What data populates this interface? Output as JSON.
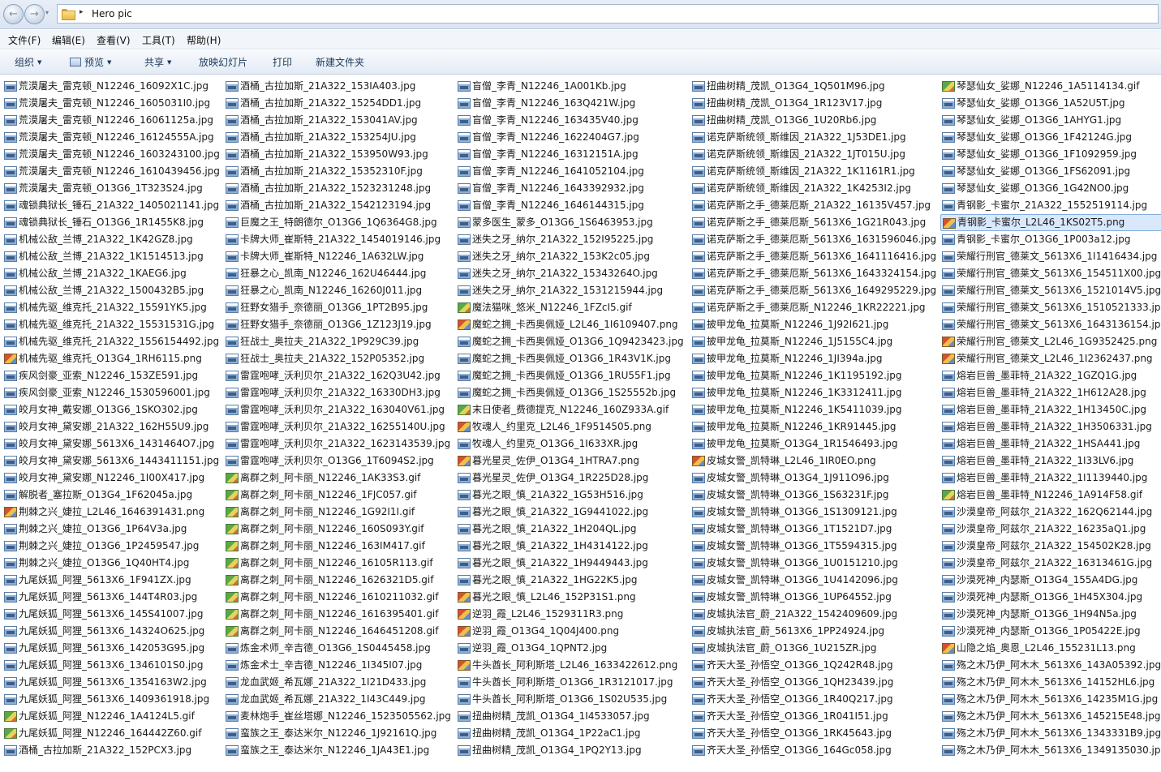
{
  "address_bar": {
    "back_icon": "←",
    "forward_icon": "→",
    "history_icon": "▾",
    "chevron_icon": "▸",
    "folder_name": "Hero pic"
  },
  "menu": [
    {
      "label": "文件(F)"
    },
    {
      "label": "编辑(E)"
    },
    {
      "label": "查看(V)"
    },
    {
      "label": "工具(T)"
    },
    {
      "label": "帮助(H)"
    }
  ],
  "toolbar": {
    "organize": "组织",
    "preview": "预览",
    "share": "共享",
    "slideshow": "放映幻灯片",
    "print": "打印",
    "new_folder": "新建文件夹",
    "arrow": "▼"
  },
  "columns": [
    [
      "荒漠屠夫_雷克顿_N12246_16092X1C.jpg",
      "荒漠屠夫_雷克顿_N12246_1605031I0.jpg",
      "荒漠屠夫_雷克顿_N12246_16061125a.jpg",
      "荒漠屠夫_雷克顿_N12246_16124555A.jpg",
      "荒漠屠夫_雷克顿_N12246_1603243100.jpg",
      "荒漠屠夫_雷克顿_N12246_1610439456.jpg",
      "荒漠屠夫_雷克顿_O13G6_1T323S24.jpg",
      "魂锁典狱长_锤石_21A322_1405021141.jpg",
      "魂锁典狱长_锤石_O13G6_1R1455K8.jpg",
      "机械公敌_兰博_21A322_1K42GZ8.jpg",
      "机械公敌_兰博_21A322_1K1514513.jpg",
      "机械公敌_兰博_21A322_1KAEG6.jpg",
      "机械公敌_兰博_21A322_1500432B5.jpg",
      "机械先驱_维克托_21A322_15591YK5.jpg",
      "机械先驱_维克托_21A322_15531531G.jpg",
      "机械先驱_维克托_21A322_1556154492.jpg",
      "机械先驱_维克托_O13G4_1RH6115.png",
      "疾风剑豪_亚索_N12246_153ZE591.jpg",
      "疾风剑豪_亚索_N12246_1530596001.jpg",
      "皎月女神_戴安娜_O13G6_1SKO302.jpg",
      "皎月女神_黛安娜_21A322_162H55U9.jpg",
      "皎月女神_黛安娜_5613X6_1431464O7.jpg",
      "皎月女神_黛安娜_5613X6_1443411151.jpg",
      "皎月女神_黛安娜_N12246_1I00X417.jpg",
      "解脱者_塞拉斯_O13G4_1F62045a.jpg",
      "荆棘之兴_婕拉_L2L46_1646391431.png",
      "荆棘之兴_婕拉_O13G6_1P64V3a.jpg",
      "荆棘之兴_婕拉_O13G6_1P2459547.jpg",
      "荆棘之兴_婕拉_O13G6_1Q40HT4.jpg",
      "九尾妖狐_阿狸_5613X6_1F941ZX.jpg",
      "九尾妖狐_阿狸_5613X6_144T4R03.jpg",
      "九尾妖狐_阿狸_5613X6_145S41007.jpg",
      "九尾妖狐_阿狸_5613X6_14324O625.jpg",
      "九尾妖狐_阿狸_5613X6_142053G95.jpg",
      "九尾妖狐_阿狸_5613X6_1346101S0.jpg",
      "九尾妖狐_阿狸_5613X6_1354163W2.jpg",
      "九尾妖狐_阿狸_5613X6_1409361918.jpg",
      "九尾妖狐_阿狸_N12246_1A4124L5.gif",
      "九尾妖狐_阿狸_N12246_164442Z60.gif",
      "酒桶_古拉加斯_21A322_152PCX3.jpg"
    ],
    [
      "酒桶_古拉加斯_21A322_153IA403.jpg",
      "酒桶_古拉加斯_21A322_15254DD1.jpg",
      "酒桶_古拉加斯_21A322_153041AV.jpg",
      "酒桶_古拉加斯_21A322_153254JU.jpg",
      "酒桶_古拉加斯_21A322_153950W93.jpg",
      "酒桶_古拉加斯_21A322_15352310F.jpg",
      "酒桶_古拉加斯_21A322_1523231248.jpg",
      "酒桶_古拉加斯_21A322_1542123194.jpg",
      "巨魔之王_特朗德尔_O13G6_1Q6364G8.jpg",
      "卡牌大师_崔斯特_21A322_1454019146.jpg",
      "卡牌大师_崔斯特_N12246_1A632LW.jpg",
      "狂暴之心_凯南_N12246_162U46444.jpg",
      "狂暴之心_凯南_N12246_16260J011.jpg",
      "狂野女猎手_奈德丽_O13G6_1PT2B95.jpg",
      "狂野女猎手_奈德丽_O13G6_1Z123J19.jpg",
      "狂战士_奥拉夫_21A322_1P929C39.jpg",
      "狂战士_奥拉夫_21A322_152P05352.jpg",
      "雷霆咆哮_沃利贝尔_21A322_162Q3U42.jpg",
      "雷霆咆哮_沃利贝尔_21A322_16330DH3.jpg",
      "雷霆咆哮_沃利贝尔_21A322_163040V61.jpg",
      "雷霆咆哮_沃利贝尔_21A322_16255140U.jpg",
      "雷霆咆哮_沃利贝尔_21A322_1623143539.jpg",
      "雷霆咆哮_沃利贝尔_O13G6_1T6094S2.jpg",
      "离群之刺_阿卡丽_N12246_1AK33S3.gif",
      "离群之刺_阿卡丽_N12246_1FJC057.gif",
      "离群之刺_阿卡丽_N12246_1G92I1I.gif",
      "离群之刺_阿卡丽_N12246_160S093Y.gif",
      "离群之刺_阿卡丽_N12246_163IM417.gif",
      "离群之刺_阿卡丽_N12246_16105R113.gif",
      "离群之刺_阿卡丽_N12246_1626321D5.gif",
      "离群之刺_阿卡丽_N12246_1610211032.gif",
      "离群之刺_阿卡丽_N12246_1616395401.gif",
      "离群之刺_阿卡丽_N12246_1646451208.gif",
      "炼金术师_辛吉德_O13G6_1S0445458.jpg",
      "炼金术士_辛吉德_N12246_1I345I07.jpg",
      "龙血武姬_希瓦娜_21A322_1I21D433.jpg",
      "龙血武姬_希瓦娜_21A322_1I43C449.jpg",
      "麦林炮手_崔丝塔娜_N12246_1523505562.jpg",
      "蛮族之王_泰达米尔_N12246_1J92161Q.jpg",
      "蛮族之王_泰达米尔_N12246_1JA43E1.jpg"
    ],
    [
      "盲僧_李青_N12246_1A001Kb.jpg",
      "盲僧_李青_N12246_163Q421W.jpg",
      "盲僧_李青_N12246_163435V40.jpg",
      "盲僧_李青_N12246_1622404G7.jpg",
      "盲僧_李青_N12246_16312151A.jpg",
      "盲僧_李青_N12246_1641052104.jpg",
      "盲僧_李青_N12246_1643392932.jpg",
      "盲僧_李青_N12246_1646144315.jpg",
      "蒙多医生_蒙多_O13G6_1S6463953.jpg",
      "迷失之牙_纳尔_21A322_152I95225.jpg",
      "迷失之牙_纳尔_21A322_153K2c05.jpg",
      "迷失之牙_纳尔_21A322_15343264O.jpg",
      "迷失之牙_纳尔_21A322_1531215944.jpg",
      "魔法猫咪_悠米_N12246_1FZcI5.gif",
      "魔蛇之拥_卡西奥佩娅_L2L46_1I6109407.png",
      "魔蛇之拥_卡西奥佩娅_O13G6_1Q9423423.jpg",
      "魔蛇之拥_卡西奥佩娅_O13G6_1R43V1K.jpg",
      "魔蛇之拥_卡西奥佩娅_O13G6_1RU55F1.jpg",
      "魔蛇之拥_卡西奥佩娅_O13G6_1S25552b.jpg",
      "末日使者_费德提克_N12246_160Z933A.gif",
      "牧魂人_约里克_L2L46_1F9514505.png",
      "牧魂人_约里克_O13G6_1I633XR.jpg",
      "暮光星灵_佐伊_O13G4_1HTRA7.png",
      "暮光星灵_佐伊_O13G4_1R225D28.jpg",
      "暮光之眼_慎_21A322_1G53H516.jpg",
      "暮光之眼_慎_21A322_1G9441022.jpg",
      "暮光之眼_慎_21A322_1H204QL.jpg",
      "暮光之眼_慎_21A322_1H4314122.jpg",
      "暮光之眼_慎_21A322_1H9449443.jpg",
      "暮光之眼_慎_21A322_1HG22K5.jpg",
      "暮光之眼_慎_L2L46_152P31S1.png",
      "逆羽_霞_L2L46_1529311R3.png",
      "逆羽_霞_O13G4_1Q04J400.png",
      "逆羽_霞_O13G4_1QPNT2.jpg",
      "牛头酋长_阿利斯塔_L2L46_1633422612.png",
      "牛头酋长_阿利斯塔_O13G6_1R3121017.jpg",
      "牛头酋长_阿利斯塔_O13G6_1S02U535.jpg",
      "扭曲树精_茂凯_O13G4_1I4533057.jpg",
      "扭曲树精_茂凯_O13G4_1P22aC1.jpg",
      "扭曲树精_茂凯_O13G4_1PQ2Y13.jpg"
    ],
    [
      "扭曲树精_茂凯_O13G4_1Q501M96.jpg",
      "扭曲树精_茂凯_O13G4_1R123V17.jpg",
      "扭曲树精_茂凯_O13G6_1U20Rb6.jpg",
      "诺克萨斯统领_斯维因_21A322_1J53DE1.jpg",
      "诺克萨斯统领_斯维因_21A322_1JT015U.jpg",
      "诺克萨斯统领_斯维因_21A322_1K1161R1.jpg",
      "诺克萨斯统领_斯维因_21A322_1K4253I2.jpg",
      "诺克萨斯之手_德莱厄斯_21A322_16135V457.jpg",
      "诺克萨斯之手_德莱厄斯_5613X6_1G21R043.jpg",
      "诺克萨斯之手_德莱厄斯_5613X6_1631596046.jpg",
      "诺克萨斯之手_德莱厄斯_5613X6_1641116416.jpg",
      "诺克萨斯之手_德莱厄斯_5613X6_1643324154.jpg",
      "诺克萨斯之手_德莱厄斯_5613X6_1649295229.jpg",
      "诺克萨斯之手_德莱厄斯_N12246_1KR22221.jpg",
      "披甲龙龟_拉莫斯_N12246_1J92I621.jpg",
      "披甲龙龟_拉莫斯_N12246_1J5155C4.jpg",
      "披甲龙龟_拉莫斯_N12246_1JI394a.jpg",
      "披甲龙龟_拉莫斯_N12246_1K1195192.jpg",
      "披甲龙龟_拉莫斯_N12246_1K3312411.jpg",
      "披甲龙龟_拉莫斯_N12246_1K5411039.jpg",
      "披甲龙龟_拉莫斯_N12246_1KR91445.jpg",
      "披甲龙龟_拉莫斯_O13G4_1R1546493.jpg",
      "皮城女警_凯特琳_L2L46_1IR0EO.png",
      "皮城女警_凯特琳_O13G4_1J911O96.jpg",
      "皮城女警_凯特琳_O13G6_1S63231F.jpg",
      "皮城女警_凯特琳_O13G6_1S1309121.jpg",
      "皮城女警_凯特琳_O13G6_1T1521D7.jpg",
      "皮城女警_凯特琳_O13G6_1T5594315.jpg",
      "皮城女警_凯特琳_O13G6_1U0151210.jpg",
      "皮城女警_凯特琳_O13G6_1U4142096.jpg",
      "皮城女警_凯特琳_O13G6_1UP64552.jpg",
      "皮城执法官_蔚_21A322_1542409609.jpg",
      "皮城执法官_蔚_5613X6_1PP24924.jpg",
      "皮城执法官_蔚_O13G6_1U215ZR.jpg",
      "齐天大圣_孙悟空_O13G6_1Q242R48.jpg",
      "齐天大圣_孙悟空_O13G6_1QH23439.jpg",
      "齐天大圣_孙悟空_O13G6_1R40Q217.jpg",
      "齐天大圣_孙悟空_O13G6_1R041I51.jpg",
      "齐天大圣_孙悟空_O13G6_1RK45643.jpg",
      "齐天大圣_孙悟空_O13G6_164Gc058.jpg"
    ],
    [
      "琴瑟仙女_娑娜_N12246_1A5114134.gif",
      "琴瑟仙女_娑娜_O13G6_1A52U5T.jpg",
      "琴瑟仙女_娑娜_O13G6_1AHYG1.jpg",
      "琴瑟仙女_娑娜_O13G6_1F42124G.jpg",
      "琴瑟仙女_娑娜_O13G6_1F1092959.jpg",
      "琴瑟仙女_娑娜_O13G6_1FS62091.jpg",
      "琴瑟仙女_娑娜_O13G6_1G42NO0.jpg",
      "青钢影_卡蜜尔_21A322_1552519114.jpg",
      "青钢影_卡蜜尔_L2L46_1KS02T5.png",
      "青钢影_卡蜜尔_O13G6_1P003a12.jpg",
      "荣耀行刑官_德莱文_5613X6_1I1416434.jpg",
      "荣耀行刑官_德莱文_5613X6_154511X00.jpg",
      "荣耀行刑官_德莱文_5613X6_1521014V5.jpg",
      "荣耀行刑官_德莱文_5613X6_1510521333.jpg",
      "荣耀行刑官_德莱文_5613X6_1643136154.jpg",
      "荣耀行刑官_德莱文_L2L46_1G9352425.png",
      "荣耀行刑官_德莱文_L2L46_1I2362437.png",
      "熔岩巨兽_墨菲特_21A322_1GZQ1G.jpg",
      "熔岩巨兽_墨菲特_21A322_1H612A28.jpg",
      "熔岩巨兽_墨菲特_21A322_1H13450C.jpg",
      "熔岩巨兽_墨菲特_21A322_1H3506331.jpg",
      "熔岩巨兽_墨菲特_21A322_1HSA441.jpg",
      "熔岩巨兽_墨菲特_21A322_1I33LV6.jpg",
      "熔岩巨兽_墨菲特_21A322_1I1139440.jpg",
      "熔岩巨兽_墨菲特_N12246_1A914F58.gif",
      "沙漠皇帝_阿兹尔_21A322_162Q62144.jpg",
      "沙漠皇帝_阿兹尔_21A322_16235aQ1.jpg",
      "沙漠皇帝_阿兹尔_21A322_154502K28.jpg",
      "沙漠皇帝_阿兹尔_21A322_16313461G.jpg",
      "沙漠死神_内瑟斯_O13G4_155A4DG.jpg",
      "沙漠死神_内瑟斯_O13G6_1H45X304.jpg",
      "沙漠死神_内瑟斯_O13G6_1H94N5a.jpg",
      "沙漠死神_内瑟斯_O13G6_1P05422E.jpg",
      "山隐之焰_奥恩_L2L46_155231L13.png",
      "殇之木乃伊_阿木木_5613X6_143A05392.jpg",
      "殇之木乃伊_阿木木_5613X6_14152HL6.jpg",
      "殇之木乃伊_阿木木_5613X6_14235M1G.jpg",
      "殇之木乃伊_阿木木_5613X6_145215E48.jpg",
      "殇之木乃伊_阿木木_5613X6_1343331B9.jpg",
      "殇之木乃伊_阿木木_5613X6_1349135030.jpg"
    ]
  ],
  "selected_file": "青钢影_卡蜜尔_L2L46_1KS02T5.png",
  "icon_names": {
    "jpg": "jpg-file-icon",
    "png": "png-file-icon",
    "gif": "gif-file-icon"
  }
}
